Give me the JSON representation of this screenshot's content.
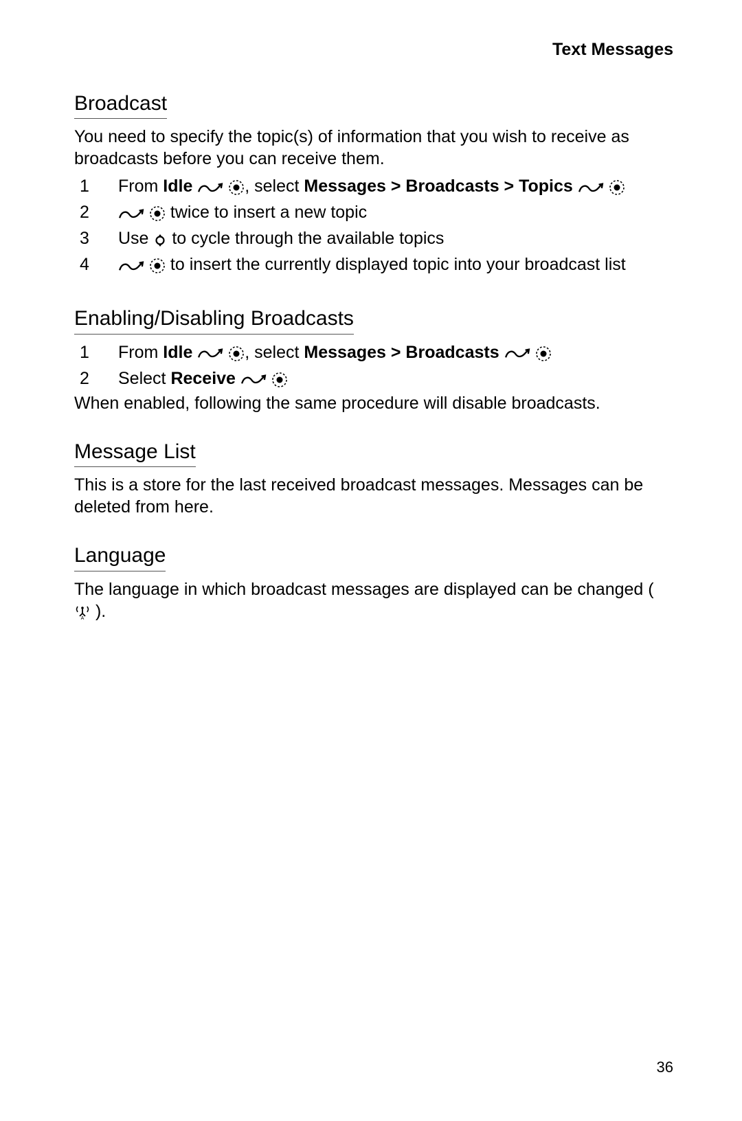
{
  "header": {
    "title": "Text Messages"
  },
  "sections": {
    "broadcast": {
      "heading": "Broadcast",
      "intro": "You need to specify the topic(s) of information that you wish to receive as broadcasts before you can receive them.",
      "steps": [
        {
          "n": "1",
          "pre": "From ",
          "b1": "Idle",
          "mid": " ",
          "afterIcons": ", select  ",
          "b2": "Messages > Broadcasts > Topics"
        },
        {
          "n": "2",
          "tail": " twice to insert a new topic"
        },
        {
          "n": "3",
          "pre": "Use ",
          "tail": " to cycle through the available topics"
        },
        {
          "n": "4",
          "tail": " to insert the currently displayed topic into your broadcast list"
        }
      ]
    },
    "enable": {
      "heading": "Enabling/Disabling Broadcasts",
      "steps": [
        {
          "n": "1",
          "pre": "From ",
          "b1": "Idle",
          "afterIcons": ", select ",
          "b2": "Messages > Broadcasts"
        },
        {
          "n": "2",
          "pre": "Select ",
          "b1": "Receive"
        }
      ],
      "note": "When enabled, following the same procedure will disable broadcasts."
    },
    "msglist": {
      "heading": "Message List",
      "body": "This is a store for the last received broadcast messages. Messages can be deleted from here."
    },
    "language": {
      "heading": "Language",
      "body_pre": "The language in which broadcast messages are displayed can be changed ( ",
      "body_post": " )."
    }
  },
  "page_number": "36"
}
